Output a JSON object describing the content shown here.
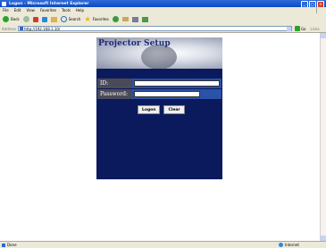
{
  "window": {
    "title": "Logon - Microsoft Internet Explorer"
  },
  "menu": [
    "File",
    "Edit",
    "View",
    "Favorites",
    "Tools",
    "Help"
  ],
  "toolbar": {
    "back_label": "Back",
    "search_label": "Search",
    "favorites_label": "Favorites"
  },
  "address": {
    "label": "Address",
    "url": "http://192.168.1.10/",
    "go_label": "Go",
    "links_label": "Links"
  },
  "page": {
    "product_title": "Projector Setup",
    "id_label": "ID:",
    "password_label": "Password:",
    "logon_label": "Logon",
    "clear_label": "Clear"
  },
  "status": {
    "text": "Done",
    "zone": "Internet"
  }
}
